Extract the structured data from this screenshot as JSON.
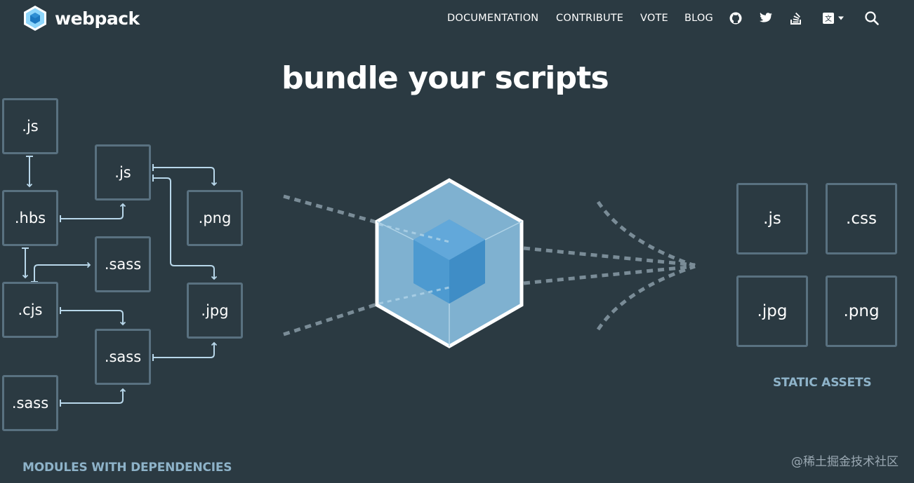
{
  "header": {
    "brand": "webpack",
    "nav": [
      {
        "label": "DOCUMENTATION"
      },
      {
        "label": "CONTRIBUTE"
      },
      {
        "label": "VOTE"
      },
      {
        "label": "BLOG"
      }
    ],
    "icons": [
      "github-icon",
      "twitter-icon",
      "stack-overflow-icon",
      "language-icon",
      "chevron-down-icon",
      "search-icon"
    ]
  },
  "hero": {
    "headline": "bundle your scripts"
  },
  "modules": {
    "caption": "MODULES WITH DEPENDENCIES",
    "items": [
      ".js",
      ".hbs",
      ".cjs",
      ".sass",
      ".js",
      ".sass",
      ".sass",
      ".png",
      ".jpg"
    ]
  },
  "assets": {
    "caption": "STATIC ASSETS",
    "items": [
      ".js",
      ".css",
      ".jpg",
      ".png"
    ]
  },
  "watermark": "@稀土掘金技术社区",
  "colors": {
    "background": "#2b3a42",
    "box_border": "#597180",
    "connector": "#b8d7ea",
    "caption": "#8eb3c9",
    "cube_outer": "#8ed6fb",
    "cube_inner": "#1c78c0"
  }
}
